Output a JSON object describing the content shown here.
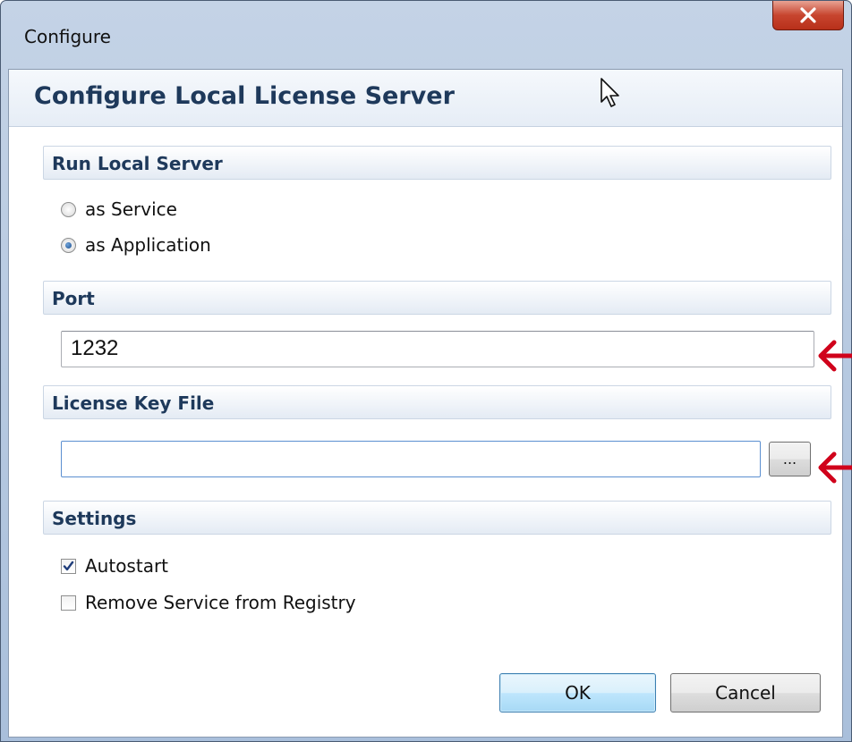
{
  "window": {
    "title": "Configure",
    "close_glyph": "X"
  },
  "dialog": {
    "heading": "Configure Local License Server"
  },
  "run_local_server": {
    "header": "Run Local Server",
    "options": [
      {
        "label": "as Service",
        "selected": false
      },
      {
        "label": "as Application",
        "selected": true
      }
    ]
  },
  "port": {
    "header": "Port",
    "value": "1232"
  },
  "license_key_file": {
    "header": "License Key File",
    "value": "",
    "browse_label": "..."
  },
  "settings": {
    "header": "Settings",
    "options": [
      {
        "label": "Autostart",
        "checked": true
      },
      {
        "label": "Remove Service from Registry",
        "checked": false
      }
    ]
  },
  "buttons": {
    "ok": "OK",
    "cancel": "Cancel"
  },
  "annotations": {
    "arrow_color": "#d0021b",
    "arrow_count": 2
  },
  "icons": [
    "close-icon",
    "mouse-cursor-icon",
    "red-arrow-icon"
  ]
}
